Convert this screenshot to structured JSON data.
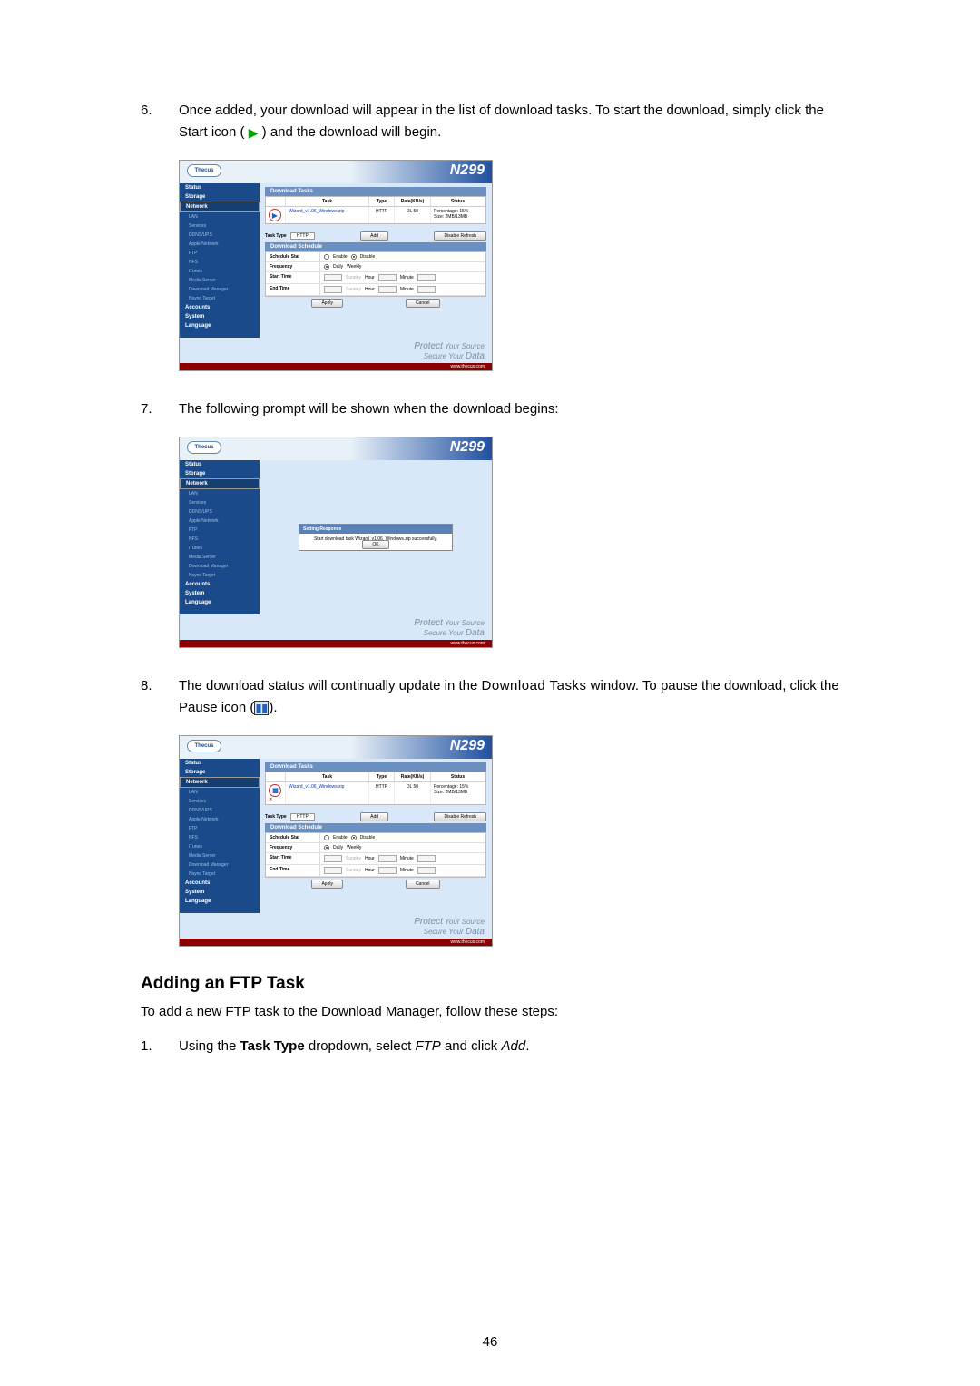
{
  "page_number": "46",
  "steps": {
    "s6": {
      "num": "6.",
      "text_a": "Once added, your download will appear in the list of download tasks. To start the download, simply click the Start icon (",
      "text_b": ") and the download will begin."
    },
    "s7": {
      "num": "7.",
      "text": "The following prompt will be shown when the download begins:"
    },
    "s8": {
      "num": "8.",
      "text_a": "The download status will continually update in the ",
      "dl_tasks": "Download Tasks",
      "text_b": " window. To pause the download, click the Pause icon (",
      "text_c": ")."
    }
  },
  "ftp_heading": "Adding an FTP Task",
  "ftp_intro": "To add a new FTP task to the Download Manager, follow these steps:",
  "ftp_step1": {
    "num": "1.",
    "a": "Using the ",
    "b": "Task Type",
    "c": " dropdown, select ",
    "d": "FTP",
    "e": " and click ",
    "f": "Add",
    "g": "."
  },
  "ui": {
    "logo": "Thecus",
    "model": "N299",
    "protect_a": "Protect",
    "protect_b": " Your Source",
    "protect_c": "Secure Your ",
    "protect_d": "Data",
    "urlbar": "www.thecus.com",
    "sidebar_cats": {
      "status": "Status",
      "storage": "Storage",
      "network": "Network",
      "accounts": "Accounts",
      "system": "System",
      "language": "Language"
    },
    "sidebar_items": {
      "lan": "LAN",
      "services": "Services",
      "ddns": "DDNS/UPS",
      "apple": "Apple Network",
      "ftp": "FTP",
      "nfs": "NFS",
      "itunes": "iTunes",
      "media": "Media Server",
      "dlmgr": "Download Manager",
      "nsync": "Nsync Target"
    },
    "dl_tasks_title": "Download Tasks",
    "cols": {
      "task": "Task",
      "type": "Type",
      "rate": "Rate(KB/s)",
      "status": "Status"
    },
    "row1": {
      "task": "Wizard_v1.06_Windows.zip",
      "type": "HTTP",
      "rate": "DL 50",
      "status1": "Percentage: 15%",
      "status2": "Size: 2MB/13MB"
    },
    "task_type_label": "Task Type",
    "task_type_value": "HTTP",
    "add_btn": "Add",
    "disable_refresh_btn": "Disable Refresh",
    "dl_schedule_title": "Download Schedule",
    "sched": {
      "stat": "Schedule Stat",
      "enable": "Enable",
      "disable": "Disable",
      "freq": "Frequency",
      "daily": "Daily",
      "weekly": "Weekly",
      "start": "Start Time",
      "end": "End Time",
      "sunday": "Sunday",
      "hour": "Hour",
      "minute": "Minute"
    },
    "apply": "Apply",
    "cancel": "Cancel",
    "dialog": {
      "title": "Setting Response",
      "msg": "Start download task Wizard_v1.06_Windows.zip successfully.",
      "ok": "OK"
    }
  }
}
